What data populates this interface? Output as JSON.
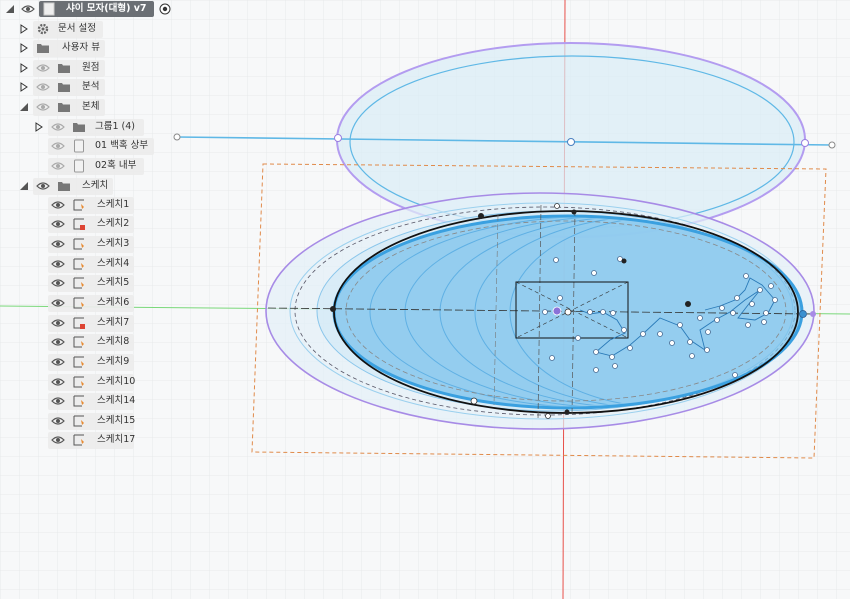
{
  "browser": {
    "root": {
      "label": "샤이 모자(대형) v7"
    },
    "items": [
      {
        "label": "문서 설정",
        "icon": "gear-icon"
      },
      {
        "label": "사용자 뷰",
        "icon": "folder-icon"
      },
      {
        "label": "원점",
        "icon": "folder-icon"
      },
      {
        "label": "분석",
        "icon": "folder-icon"
      },
      {
        "label": "본체",
        "icon": "folder-icon"
      },
      {
        "label": "그룹1 (4)",
        "icon": "folder-icon"
      },
      {
        "label": "01 백혹 상부",
        "icon": "body-icon"
      },
      {
        "label": "02혹 내부",
        "icon": "body-icon"
      },
      {
        "label": "스케치",
        "icon": "folder-icon"
      }
    ],
    "sketches": [
      "스케치1",
      "스케치2",
      "스케치3",
      "스케치4",
      "스케치5",
      "스케치6",
      "스케치7",
      "스케치8",
      "스케치9",
      "스케치10",
      "스케치14",
      "스케치15",
      "스케치17"
    ]
  },
  "colors": {
    "grid": "#dfe1e3",
    "axis_red": "#e8504a",
    "axis_green": "#6ad06a",
    "sketch_blue": "#3aa0e0",
    "fill_blue": "#7cc3ec",
    "purple": "#a78be6",
    "orange": "#e08a4a"
  }
}
